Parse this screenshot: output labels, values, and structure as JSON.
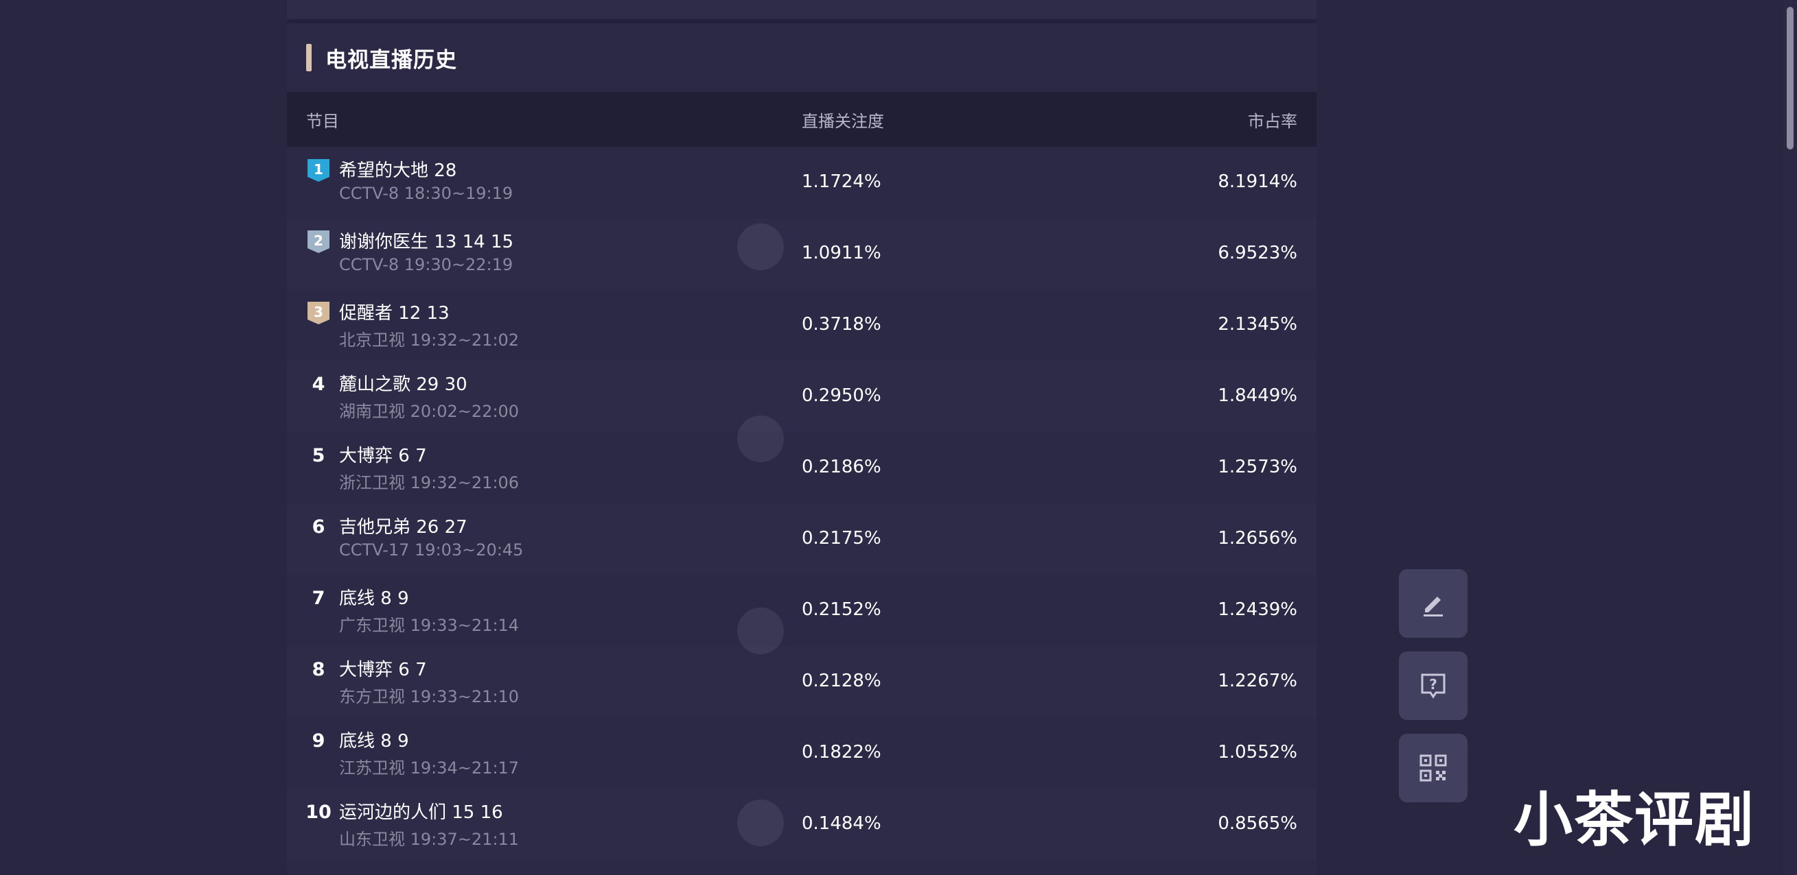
{
  "section": {
    "title": "电视直播历史"
  },
  "table": {
    "headers": {
      "program": "节目",
      "attention": "直播关注度",
      "share": "市占率"
    },
    "rows": [
      {
        "rank": "1",
        "name": "希望的大地 28",
        "sub": "CCTV-8 18:30~19:19",
        "attention": "1.1724%",
        "share": "8.1914%",
        "medal": "gold-blue"
      },
      {
        "rank": "2",
        "name": "谢谢你医生 13 14 15",
        "sub": "CCTV-8 19:30~22:19",
        "attention": "1.0911%",
        "share": "6.9523%",
        "medal": "silver"
      },
      {
        "rank": "3",
        "name": "促醒者 12 13",
        "sub": "北京卫视 19:32~21:02",
        "attention": "0.3718%",
        "share": "2.1345%",
        "medal": "bronze"
      },
      {
        "rank": "4",
        "name": "麓山之歌 29 30",
        "sub": "湖南卫视 20:02~22:00",
        "attention": "0.2950%",
        "share": "1.8449%"
      },
      {
        "rank": "5",
        "name": "大博弈 6 7",
        "sub": "浙江卫视 19:32~21:06",
        "attention": "0.2186%",
        "share": "1.2573%"
      },
      {
        "rank": "6",
        "name": "吉他兄弟 26 27",
        "sub": "CCTV-17 19:03~20:45",
        "attention": "0.2175%",
        "share": "1.2656%"
      },
      {
        "rank": "7",
        "name": "底线 8 9",
        "sub": "广东卫视 19:33~21:14",
        "attention": "0.2152%",
        "share": "1.2439%"
      },
      {
        "rank": "8",
        "name": "大博弈 6 7",
        "sub": "东方卫视 19:33~21:10",
        "attention": "0.2128%",
        "share": "1.2267%"
      },
      {
        "rank": "9",
        "name": "底线 8 9",
        "sub": "江苏卫视 19:34~21:17",
        "attention": "0.1822%",
        "share": "1.0552%"
      },
      {
        "rank": "10",
        "name": "运河边的人们 15 16",
        "sub": "山东卫视 19:37~21:11",
        "attention": "0.1484%",
        "share": "0.8565%"
      }
    ]
  },
  "float_buttons": [
    {
      "icon": "edit-icon"
    },
    {
      "icon": "question-icon"
    },
    {
      "icon": "qrcode-icon"
    }
  ],
  "brand": {
    "text": "小茶评剧"
  },
  "colors": {
    "background": "#282641",
    "accent": "#d8c3ae",
    "header_row": "#211f36",
    "button": "#41405f"
  }
}
